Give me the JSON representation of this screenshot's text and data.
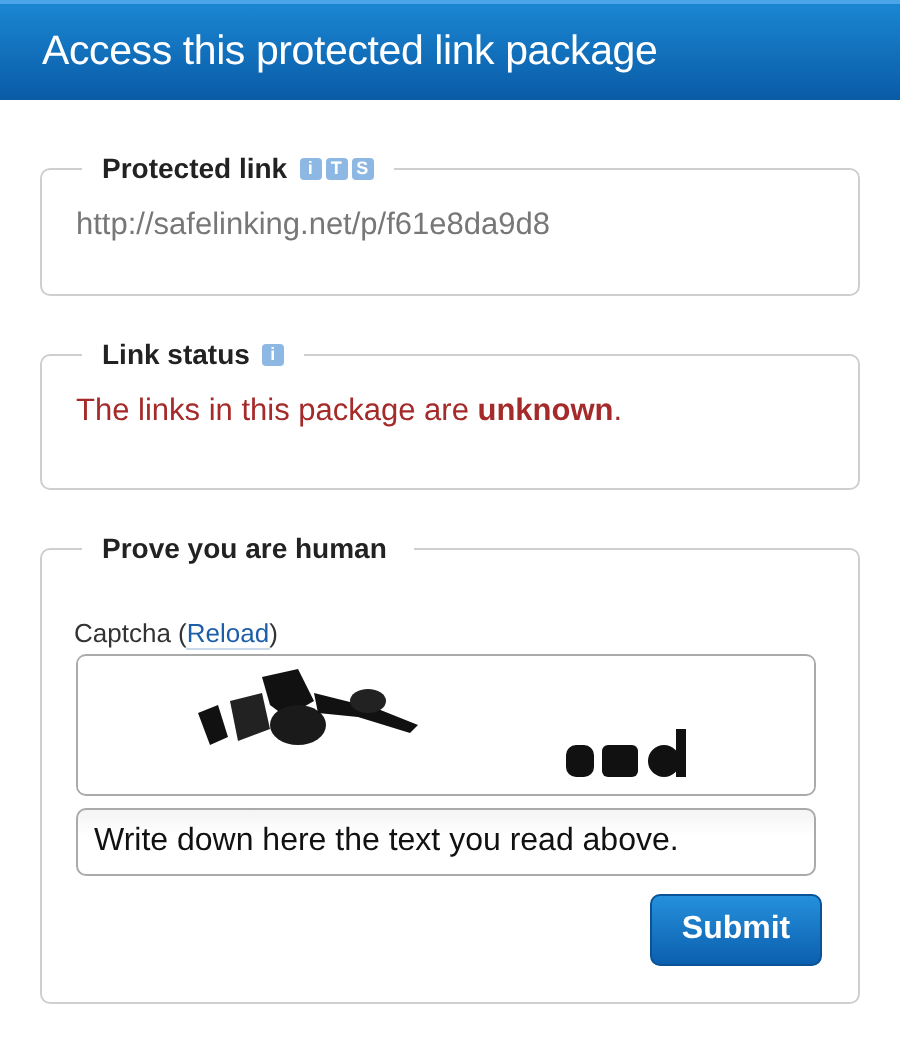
{
  "header": {
    "title": "Access this protected link package"
  },
  "panels": [
    {
      "kind": "link",
      "title": "Protected link",
      "badges": [
        "i",
        "T",
        "S"
      ],
      "url": "http://safelinking.net/p/f61e8da9d8"
    },
    {
      "kind": "status",
      "title": "Link status",
      "badges": [
        "i"
      ],
      "message": "The links in this package are **unknown**."
    },
    {
      "kind": "captcha",
      "title": "Prove you are human",
      "label": "Captcha (",
      "reload_link": "Reload",
      "label_end": ")",
      "answer": {
        "value": "Write down here the text you read above."
      },
      "submit": "Submit"
    }
  ]
}
